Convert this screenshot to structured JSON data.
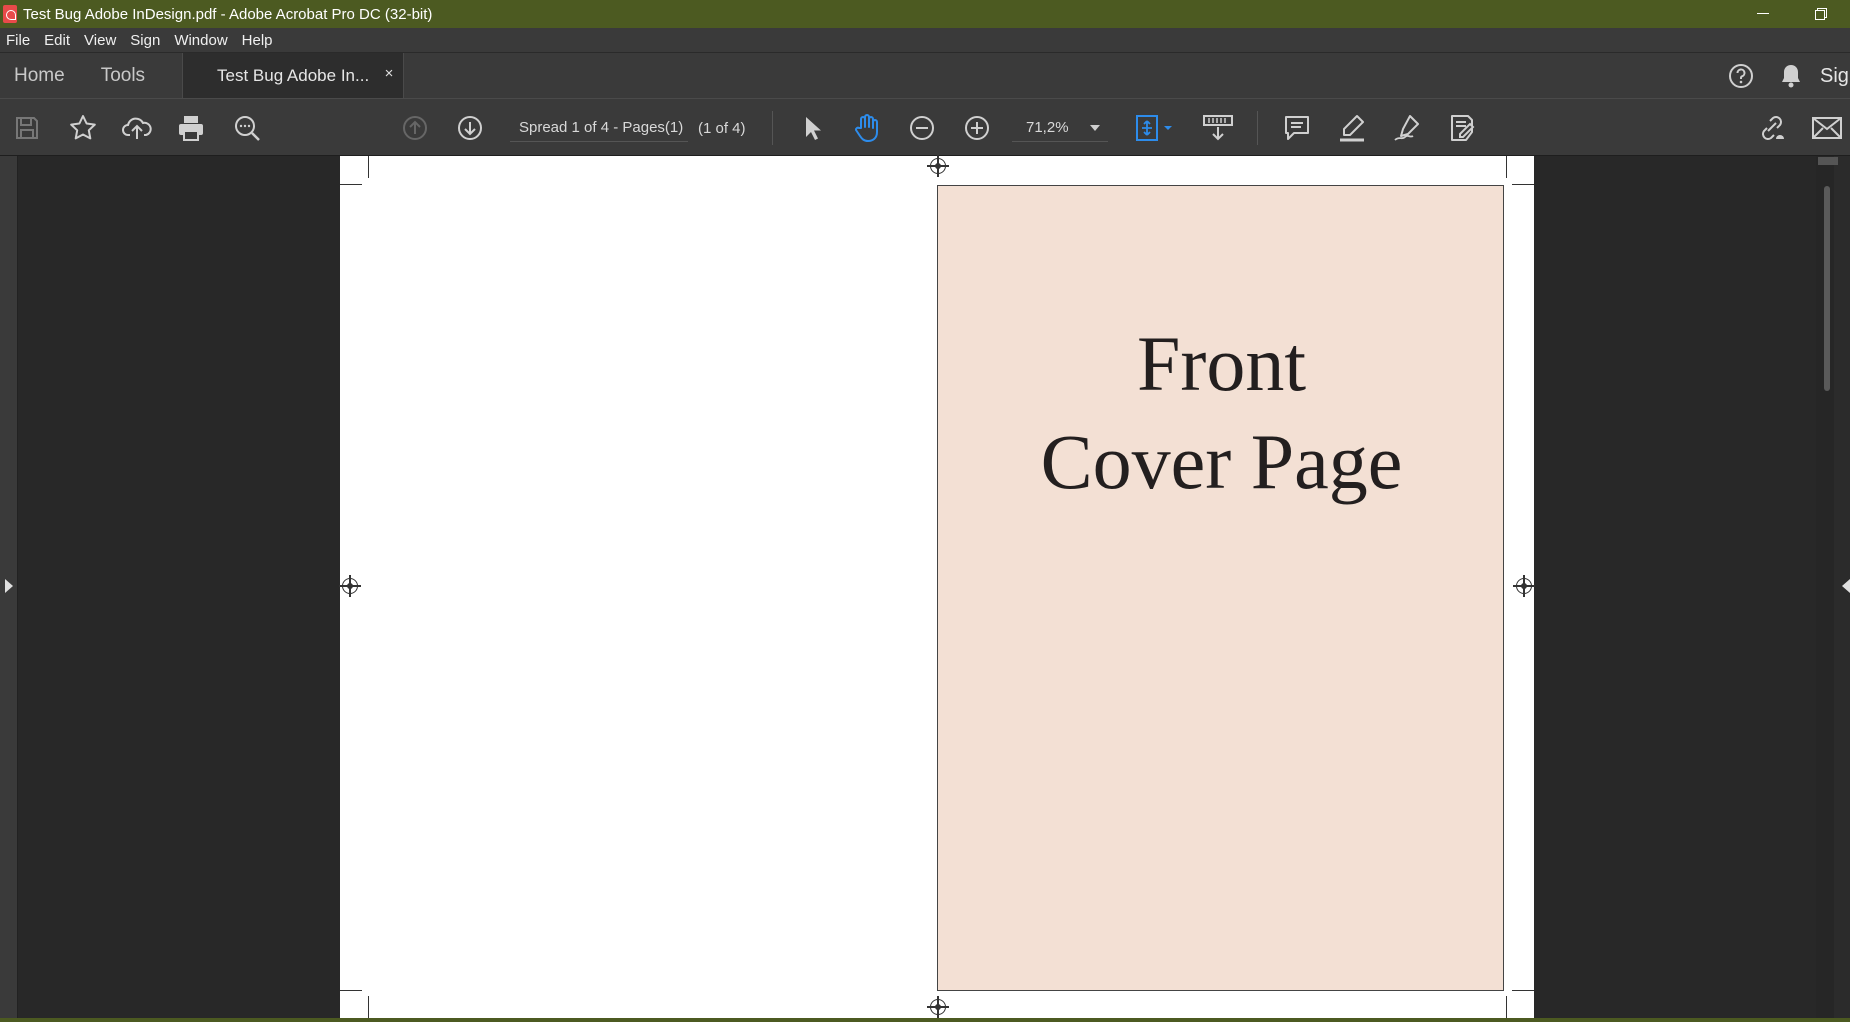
{
  "window": {
    "title": "Test Bug Adobe InDesign.pdf - Adobe Acrobat Pro DC (32-bit)"
  },
  "menu": [
    "File",
    "Edit",
    "View",
    "Sign",
    "Window",
    "Help"
  ],
  "tabs": {
    "home": "Home",
    "tools": "Tools",
    "document": "Test Bug Adobe In...",
    "close": "×",
    "sign_truncated": "Sig"
  },
  "toolbar": {
    "page_label": "Spread 1 of 4 - Pages(1)",
    "page_count": "(1 of 4)",
    "zoom": "71,2%"
  },
  "document": {
    "cover_line1": "Front",
    "cover_line2": "Cover Page",
    "cover_color": "#f3e0d4"
  },
  "icons": [
    "save-icon",
    "star-icon",
    "upload-icon",
    "print-icon",
    "zoom-search-icon",
    "page-up-icon",
    "page-down-icon",
    "select-arrow-icon",
    "hand-icon",
    "zoom-out-icon",
    "zoom-in-icon",
    "fit-page-icon",
    "scroll-mode-icon",
    "comment-icon",
    "highlight-icon",
    "sign-pen-icon",
    "stamp-icon",
    "link-share-icon",
    "mail-icon",
    "help-icon",
    "bell-icon"
  ],
  "colors": {
    "titlebar": "#4c5a21",
    "accent": "#2d8ceb"
  }
}
